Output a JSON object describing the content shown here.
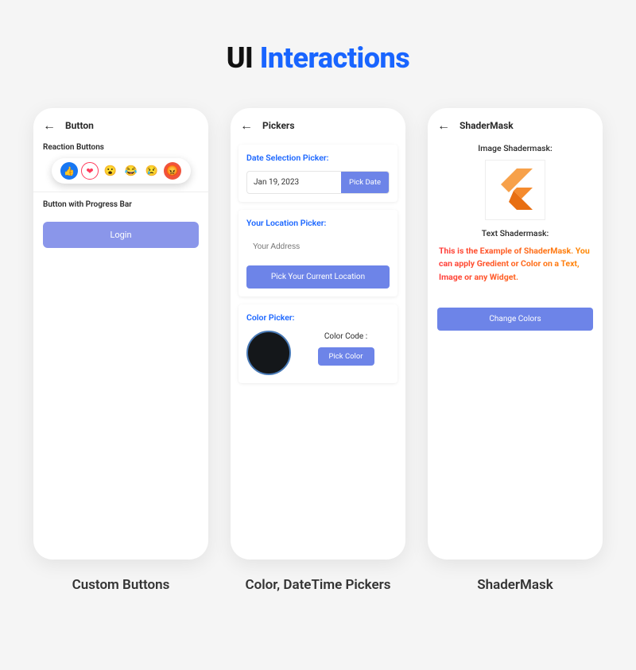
{
  "title": {
    "part1": "UI",
    "part2": "Interactions"
  },
  "accent_color": "#1965ff",
  "button_color": "#6d84e8",
  "phones": {
    "buttons": {
      "appbar_title": "Button",
      "reaction_label": "Reaction Buttons",
      "progress_label": "Button with Progress Bar",
      "login_label": "Login",
      "reactions": [
        "like",
        "love",
        "wow",
        "haha",
        "sad",
        "angry"
      ],
      "caption": "Custom Buttons"
    },
    "pickers": {
      "appbar_title": "Pickers",
      "date_section_title": "Date Selection Picker:",
      "date_value": "Jan 19, 2023",
      "pick_date_label": "Pick Date",
      "location_section_title": "Your Location Picker:",
      "address_placeholder": "Your Address",
      "pick_location_label": "Pick Your Current Location",
      "color_section_title": "Color Picker:",
      "color_code_label": "Color Code :",
      "pick_color_label": "Pick Color",
      "color_value": "#14171a",
      "caption": "Color, DateTime Pickers"
    },
    "shadermask": {
      "appbar_title": "ShaderMask",
      "image_label": "Image Shadermask:",
      "text_label": "Text Shadermask:",
      "gradient_text": "This is the Example of ShaderMask. You can apply Gredient or Color on a Text, Image or any Widget.",
      "change_colors_label": "Change Colors",
      "caption": "ShaderMask"
    }
  }
}
